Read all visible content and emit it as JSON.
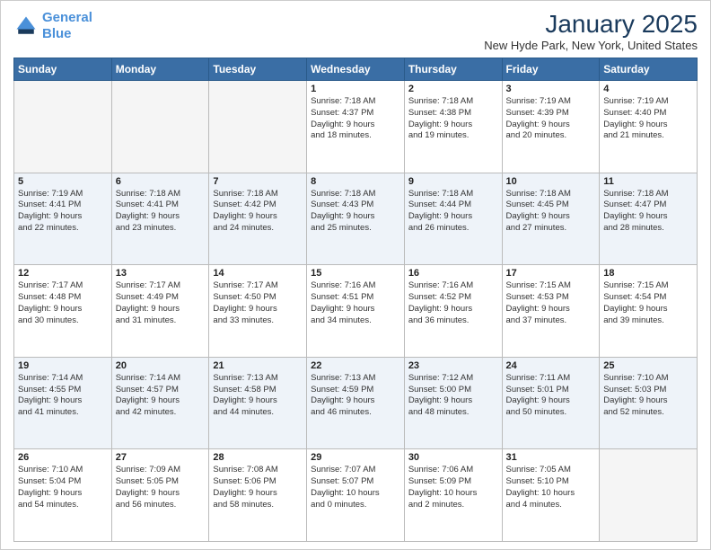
{
  "header": {
    "logo_line1": "General",
    "logo_line2": "Blue",
    "month_title": "January 2025",
    "location": "New Hyde Park, New York, United States"
  },
  "weekdays": [
    "Sunday",
    "Monday",
    "Tuesday",
    "Wednesday",
    "Thursday",
    "Friday",
    "Saturday"
  ],
  "weeks": [
    [
      {
        "day": "",
        "info": ""
      },
      {
        "day": "",
        "info": ""
      },
      {
        "day": "",
        "info": ""
      },
      {
        "day": "1",
        "info": "Sunrise: 7:18 AM\nSunset: 4:37 PM\nDaylight: 9 hours\nand 18 minutes."
      },
      {
        "day": "2",
        "info": "Sunrise: 7:18 AM\nSunset: 4:38 PM\nDaylight: 9 hours\nand 19 minutes."
      },
      {
        "day": "3",
        "info": "Sunrise: 7:19 AM\nSunset: 4:39 PM\nDaylight: 9 hours\nand 20 minutes."
      },
      {
        "day": "4",
        "info": "Sunrise: 7:19 AM\nSunset: 4:40 PM\nDaylight: 9 hours\nand 21 minutes."
      }
    ],
    [
      {
        "day": "5",
        "info": "Sunrise: 7:19 AM\nSunset: 4:41 PM\nDaylight: 9 hours\nand 22 minutes."
      },
      {
        "day": "6",
        "info": "Sunrise: 7:18 AM\nSunset: 4:41 PM\nDaylight: 9 hours\nand 23 minutes."
      },
      {
        "day": "7",
        "info": "Sunrise: 7:18 AM\nSunset: 4:42 PM\nDaylight: 9 hours\nand 24 minutes."
      },
      {
        "day": "8",
        "info": "Sunrise: 7:18 AM\nSunset: 4:43 PM\nDaylight: 9 hours\nand 25 minutes."
      },
      {
        "day": "9",
        "info": "Sunrise: 7:18 AM\nSunset: 4:44 PM\nDaylight: 9 hours\nand 26 minutes."
      },
      {
        "day": "10",
        "info": "Sunrise: 7:18 AM\nSunset: 4:45 PM\nDaylight: 9 hours\nand 27 minutes."
      },
      {
        "day": "11",
        "info": "Sunrise: 7:18 AM\nSunset: 4:47 PM\nDaylight: 9 hours\nand 28 minutes."
      }
    ],
    [
      {
        "day": "12",
        "info": "Sunrise: 7:17 AM\nSunset: 4:48 PM\nDaylight: 9 hours\nand 30 minutes."
      },
      {
        "day": "13",
        "info": "Sunrise: 7:17 AM\nSunset: 4:49 PM\nDaylight: 9 hours\nand 31 minutes."
      },
      {
        "day": "14",
        "info": "Sunrise: 7:17 AM\nSunset: 4:50 PM\nDaylight: 9 hours\nand 33 minutes."
      },
      {
        "day": "15",
        "info": "Sunrise: 7:16 AM\nSunset: 4:51 PM\nDaylight: 9 hours\nand 34 minutes."
      },
      {
        "day": "16",
        "info": "Sunrise: 7:16 AM\nSunset: 4:52 PM\nDaylight: 9 hours\nand 36 minutes."
      },
      {
        "day": "17",
        "info": "Sunrise: 7:15 AM\nSunset: 4:53 PM\nDaylight: 9 hours\nand 37 minutes."
      },
      {
        "day": "18",
        "info": "Sunrise: 7:15 AM\nSunset: 4:54 PM\nDaylight: 9 hours\nand 39 minutes."
      }
    ],
    [
      {
        "day": "19",
        "info": "Sunrise: 7:14 AM\nSunset: 4:55 PM\nDaylight: 9 hours\nand 41 minutes."
      },
      {
        "day": "20",
        "info": "Sunrise: 7:14 AM\nSunset: 4:57 PM\nDaylight: 9 hours\nand 42 minutes."
      },
      {
        "day": "21",
        "info": "Sunrise: 7:13 AM\nSunset: 4:58 PM\nDaylight: 9 hours\nand 44 minutes."
      },
      {
        "day": "22",
        "info": "Sunrise: 7:13 AM\nSunset: 4:59 PM\nDaylight: 9 hours\nand 46 minutes."
      },
      {
        "day": "23",
        "info": "Sunrise: 7:12 AM\nSunset: 5:00 PM\nDaylight: 9 hours\nand 48 minutes."
      },
      {
        "day": "24",
        "info": "Sunrise: 7:11 AM\nSunset: 5:01 PM\nDaylight: 9 hours\nand 50 minutes."
      },
      {
        "day": "25",
        "info": "Sunrise: 7:10 AM\nSunset: 5:03 PM\nDaylight: 9 hours\nand 52 minutes."
      }
    ],
    [
      {
        "day": "26",
        "info": "Sunrise: 7:10 AM\nSunset: 5:04 PM\nDaylight: 9 hours\nand 54 minutes."
      },
      {
        "day": "27",
        "info": "Sunrise: 7:09 AM\nSunset: 5:05 PM\nDaylight: 9 hours\nand 56 minutes."
      },
      {
        "day": "28",
        "info": "Sunrise: 7:08 AM\nSunset: 5:06 PM\nDaylight: 9 hours\nand 58 minutes."
      },
      {
        "day": "29",
        "info": "Sunrise: 7:07 AM\nSunset: 5:07 PM\nDaylight: 10 hours\nand 0 minutes."
      },
      {
        "day": "30",
        "info": "Sunrise: 7:06 AM\nSunset: 5:09 PM\nDaylight: 10 hours\nand 2 minutes."
      },
      {
        "day": "31",
        "info": "Sunrise: 7:05 AM\nSunset: 5:10 PM\nDaylight: 10 hours\nand 4 minutes."
      },
      {
        "day": "",
        "info": ""
      }
    ]
  ]
}
